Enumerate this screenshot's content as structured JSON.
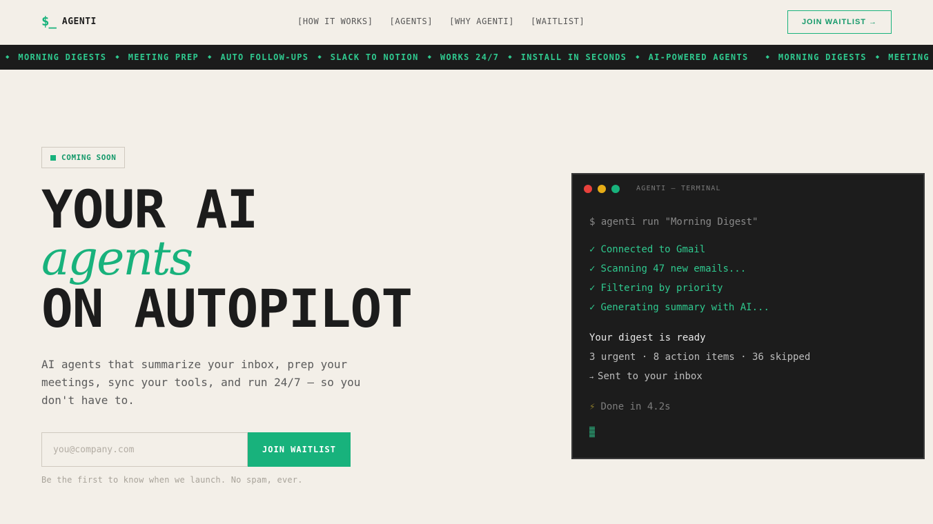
{
  "header": {
    "logo_mark": "$_",
    "logo_text": "AGENTI",
    "nav": [
      "[HOW IT WORKS]",
      "[AGENTS]",
      "[WHY AGENTI]",
      "[WAITLIST]"
    ],
    "cta": "JOIN WAITLIST →"
  },
  "ticker": {
    "items": [
      "MORNING DIGESTS",
      "MEETING PREP",
      "AUTO FOLLOW-UPS",
      "SLACK TO NOTION",
      "WORKS 24/7",
      "INSTALL IN SECONDS",
      "AI-POWERED AGENTS",
      "MORNING DIGESTS",
      "MEETING PREP"
    ],
    "separator": "◆"
  },
  "hero": {
    "badge": "COMING SOON",
    "line1": "YOUR AI",
    "line2": "agents",
    "line3": "ON AUTOPILOT",
    "subtitle": "AI agents that summarize your inbox, prep your meetings, sync your tools, and run 24/7 — so you don't have to.",
    "email_placeholder": "you@company.com",
    "join_button": "JOIN WAITLIST",
    "fine_print": "Be the first to know when we launch. No spam, ever."
  },
  "terminal": {
    "title": "AGENTI — TERMINAL",
    "command": "$ agenti run \"Morning Digest\"",
    "check_mark": "✓",
    "steps": [
      "Connected to Gmail",
      "Scanning 47 new emails...",
      "Filtering by priority",
      "Generating summary with AI..."
    ],
    "ready": "Your digest is ready",
    "stats": "3 urgent · 8 action items · 36 skipped",
    "sent_arrow": "→",
    "sent": "Sent to your inbox",
    "done_icon": "⚡",
    "done": "Done in 4.2s"
  },
  "colors": {
    "accent": "#18b27c",
    "background": "#f3efe8",
    "terminal_bg": "#1c1c1c"
  }
}
